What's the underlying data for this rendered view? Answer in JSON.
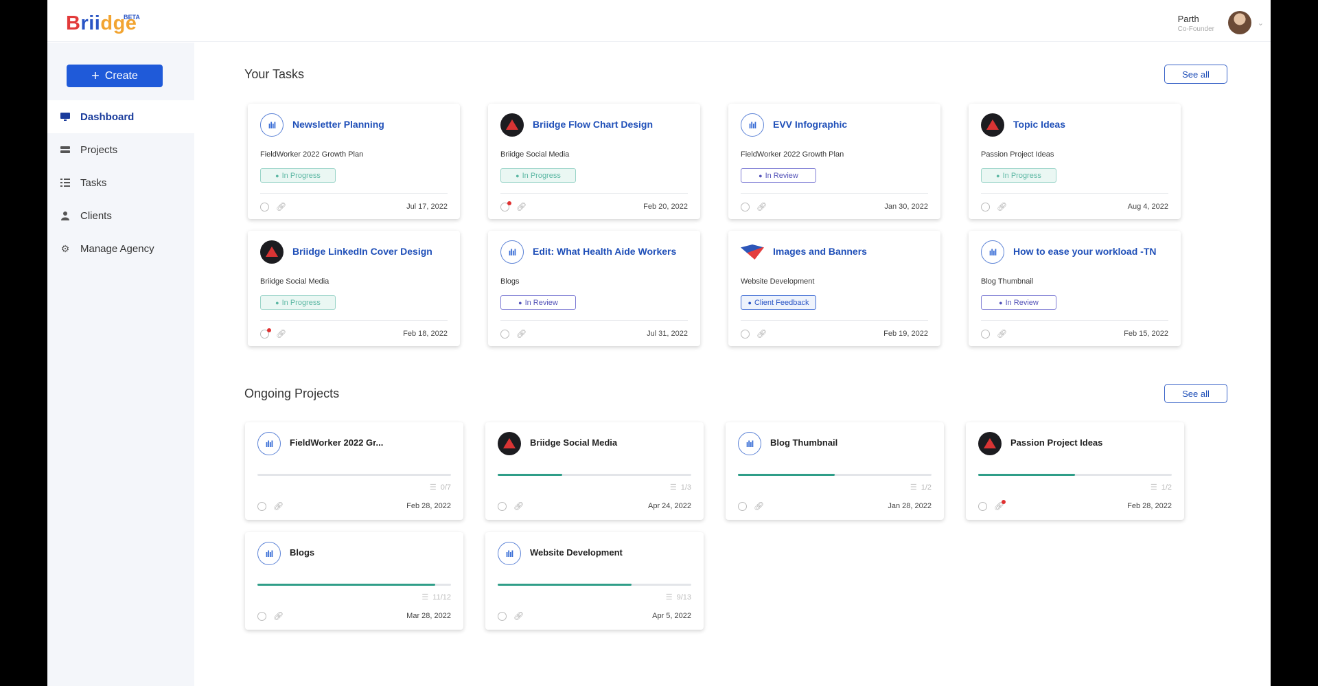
{
  "app": {
    "logo_text": "Briidge",
    "logo_badge": "BETA"
  },
  "user": {
    "name": "Parth",
    "role": "Co-Founder"
  },
  "sidebar": {
    "create_label": "Create",
    "items": [
      {
        "label": "Dashboard",
        "icon": "monitor-icon",
        "active": true
      },
      {
        "label": "Projects",
        "icon": "projects-icon",
        "active": false
      },
      {
        "label": "Tasks",
        "icon": "tasks-list-icon",
        "active": false
      },
      {
        "label": "Clients",
        "icon": "user-icon",
        "active": false
      },
      {
        "label": "Manage Agency",
        "icon": "gear-icon",
        "active": false
      }
    ]
  },
  "tasks_section": {
    "title": "Your Tasks",
    "see_all": "See all",
    "cards": [
      {
        "title": "Newsletter Planning",
        "project": "FieldWorker 2022 Growth Plan",
        "status": "In Progress",
        "date": "Jul 17, 2022",
        "icon": "wave-logo-icon"
      },
      {
        "title": "Briidge Flow Chart Design",
        "project": "Briidge Social Media",
        "status": "In Progress",
        "date": "Feb 20, 2022",
        "icon": "briidge-logo-icon"
      },
      {
        "title": "EVV Infographic",
        "project": "FieldWorker 2022 Growth Plan",
        "status": "In Review",
        "date": "Jan 30, 2022",
        "icon": "wave-logo-icon"
      },
      {
        "title": "Topic Ideas",
        "project": "Passion Project Ideas",
        "status": "In Progress",
        "date": "Aug 4, 2022",
        "icon": "briidge-logo-icon"
      },
      {
        "title": "Briidge LinkedIn Cover Design",
        "project": "Briidge Social Media",
        "status": "In Progress",
        "date": "Feb 18, 2022",
        "icon": "briidge-logo-icon"
      },
      {
        "title": "Edit: What Health Aide Workers",
        "project": "Blogs",
        "status": "In Review",
        "date": "Jul 31, 2022",
        "icon": "wave-logo-icon"
      },
      {
        "title": "Images and Banners",
        "project": "Website Development",
        "status": "Client Feedback",
        "date": "Feb 19, 2022",
        "icon": "banner-logo-icon"
      },
      {
        "title": "How to ease your workload -TN",
        "project": "Blog Thumbnail",
        "status": "In Review",
        "date": "Feb 15, 2022",
        "icon": "wave-logo-icon"
      }
    ]
  },
  "projects_section": {
    "title": "Ongoing Projects",
    "see_all": "See all",
    "cards": [
      {
        "title": "FieldWorker 2022 Gr...",
        "progress": 0.0,
        "count": "0/7",
        "date": "Feb 28, 2022",
        "icon": "wave-logo-icon"
      },
      {
        "title": "Briidge Social Media",
        "progress": 0.333,
        "count": "1/3",
        "date": "Apr 24, 2022",
        "icon": "briidge-logo-icon"
      },
      {
        "title": "Blog Thumbnail",
        "progress": 0.5,
        "count": "1/2",
        "date": "Jan 28, 2022",
        "icon": "wave-logo-icon"
      },
      {
        "title": "Passion Project Ideas",
        "progress": 0.5,
        "count": "1/2",
        "date": "Feb 28, 2022",
        "icon": "briidge-logo-icon"
      },
      {
        "title": "Blogs",
        "progress": 0.917,
        "count": "11/12",
        "date": "Mar 28, 2022",
        "icon": "wave-logo-icon"
      },
      {
        "title": "Website Development",
        "progress": 0.692,
        "count": "9/13",
        "date": "Apr 5, 2022",
        "icon": "wave-logo-icon"
      }
    ]
  },
  "colors": {
    "accent": "#1f5ad9",
    "progress_fill": "#2f9e88",
    "in_progress": "#5bb7a3",
    "in_review": "#5453b8",
    "client_feedback": "#2a55c5"
  }
}
